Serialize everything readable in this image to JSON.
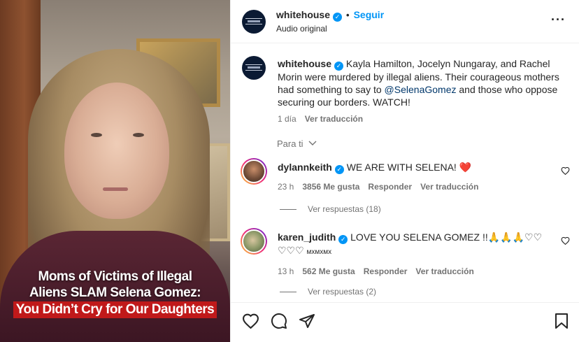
{
  "media": {
    "caption_line1": "Moms of Victims of Illegal",
    "caption_line2": "Aliens SLAM Selena Gomez:",
    "caption_line3": "You Didn’t Cry for Our Daughters"
  },
  "header": {
    "username": "whitehouse",
    "follow_label": "Seguir",
    "subtitle": "Audio original",
    "dot": "•",
    "more_icon": "···"
  },
  "post": {
    "username": "whitehouse",
    "caption_before": "Kayla Hamilton, Jocelyn Nungaray, and Rachel Morin were murdered by illegal aliens. Their courageous mothers had something to say to ",
    "mention": "@SelenaGomez",
    "caption_after": " and those who oppose securing our borders. WATCH!",
    "time": "1 día",
    "translate": "Ver traducción"
  },
  "filter": {
    "label": "Para ti"
  },
  "comments": [
    {
      "username": "dylannkeith",
      "text": "WE ARE WITH SELENA! ",
      "emoji": "❤️",
      "time": "23 h",
      "likes": "3856 Me gusta",
      "reply": "Responder",
      "translate": "Ver traducción",
      "replies": "Ver respuestas (18)"
    },
    {
      "username": "karen_judith",
      "text": "LOVE YOU SELENA GOMEZ !!",
      "emoji": "🙏🙏🙏♡♡ ♡♡♡",
      "suffix": "ᴍxᴍxᴍx",
      "time": "13 h",
      "likes": "562 Me gusta",
      "reply": "Responder",
      "translate": "Ver traducción",
      "replies": "Ver respuestas (2)"
    }
  ],
  "colors": {
    "accent": "#0095f6",
    "caption_red": "#c0191a",
    "muted": "#737373"
  }
}
